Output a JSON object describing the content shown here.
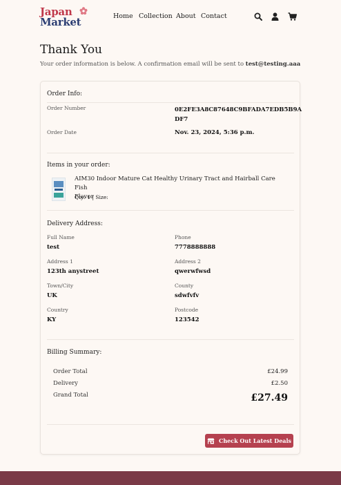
{
  "brand": {
    "line1": "Japan",
    "line2": "Market"
  },
  "nav": {
    "items": [
      "Home",
      "Collection",
      "About",
      "Contact"
    ]
  },
  "icons": {
    "search": "search-icon",
    "account": "user-icon",
    "cart": "cart-icon"
  },
  "page": {
    "title": "Thank You",
    "subtitle_prefix": "Your order information is below. A confirmation email will be sent to",
    "email": "test@testing.aaa"
  },
  "order_info": {
    "heading": "Order Info:",
    "number_label": "Order Number",
    "number_line1": "0E2FE3A8C87648C9BFADA7EDB5B9A",
    "number_line2": "DF7",
    "date_label": "Order Date",
    "date": "Nov. 23, 2024, 5:36 p.m."
  },
  "items": {
    "heading": "Items in your order:",
    "product_line1": "AIM30 Indoor Mature Cat Healthy Urinary Tract and Hairball Care Fish",
    "product_line2": "Flavor",
    "qty": "Qty: 1 | Size:"
  },
  "delivery": {
    "heading": "Delivery Address:",
    "full_name_label": "Full Name",
    "full_name": "test",
    "phone_label": "Phone",
    "phone": "7778888888",
    "address1_label": "Address 1",
    "address1": "123th anystreet",
    "address2_label": "Address 2",
    "address2": "qwerwfwsd",
    "town_label": "Town/City",
    "town": "UK",
    "county_label": "County",
    "county": "sdwfvfv",
    "country_label": "Country",
    "country": "KY",
    "postcode_label": "Postcode",
    "postcode": "123542"
  },
  "billing": {
    "heading": "Billing Summary:",
    "order_total_label": "Order Total",
    "order_total": "£24.99",
    "delivery_label": "Delivery",
    "delivery": "£2.50",
    "grand_total_label": "Grand Total",
    "grand_total": "£27.49"
  },
  "cta": {
    "label": "Check Out Latest Deals"
  },
  "colors": {
    "accent": "#b5414f",
    "footer": "#7a3a47",
    "background": "#fdf8f4"
  }
}
